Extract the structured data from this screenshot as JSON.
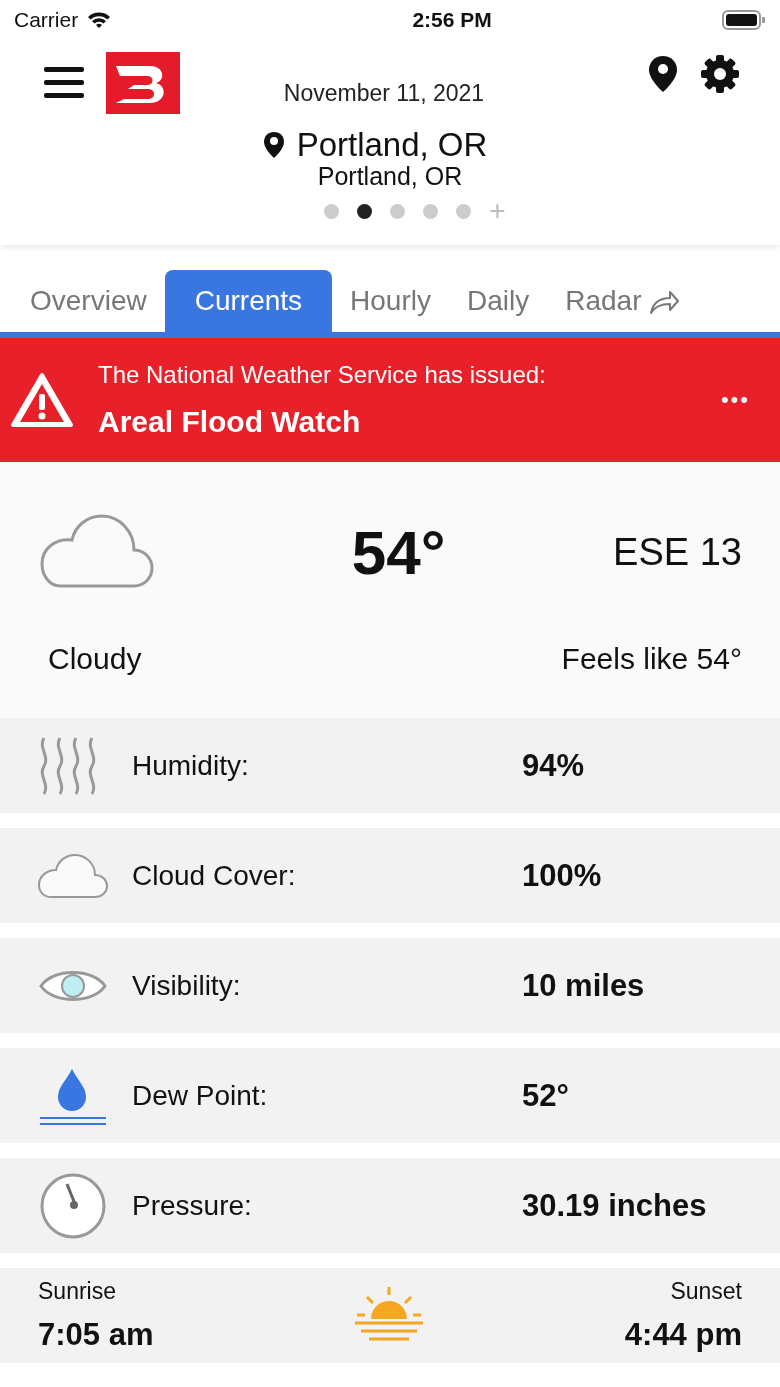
{
  "status_bar": {
    "carrier": "Carrier",
    "time": "2:56 PM"
  },
  "header": {
    "date": "November 11, 2021"
  },
  "location": {
    "name": "Portland, OR",
    "subtitle": "Portland, OR"
  },
  "pages": [
    {
      "selected": false
    },
    {
      "selected": true
    },
    {
      "selected": false
    },
    {
      "selected": false
    },
    {
      "selected": false
    }
  ],
  "add_page": "+",
  "tabs": [
    {
      "label": "Overview",
      "selected": false
    },
    {
      "label": "Currents",
      "selected": true
    },
    {
      "label": "Hourly",
      "selected": false
    },
    {
      "label": "Daily",
      "selected": false
    },
    {
      "label": "Radar",
      "selected": false
    }
  ],
  "alert": {
    "intro": "The National Weather Service has issued:",
    "title": "Areal Flood Watch",
    "more": "•••"
  },
  "current": {
    "temperature": "54°",
    "wind": "ESE 13",
    "condition": "Cloudy",
    "feels_like": "Feels like 54°"
  },
  "details": [
    {
      "kind": "humidity",
      "label": "Humidity:",
      "value": "94%"
    },
    {
      "kind": "cloud",
      "label": "Cloud Cover:",
      "value": "100%"
    },
    {
      "kind": "visibility",
      "label": "Visibility:",
      "value": "10 miles"
    },
    {
      "kind": "dew",
      "label": "Dew Point:",
      "value": "52°"
    },
    {
      "kind": "pressure",
      "label": "Pressure:",
      "value": "30.19 inches"
    }
  ],
  "sun": {
    "sunrise_label": "Sunrise",
    "sunrise": "7:05 am",
    "sunset_label": "Sunset",
    "sunset": "4:44 pm"
  }
}
